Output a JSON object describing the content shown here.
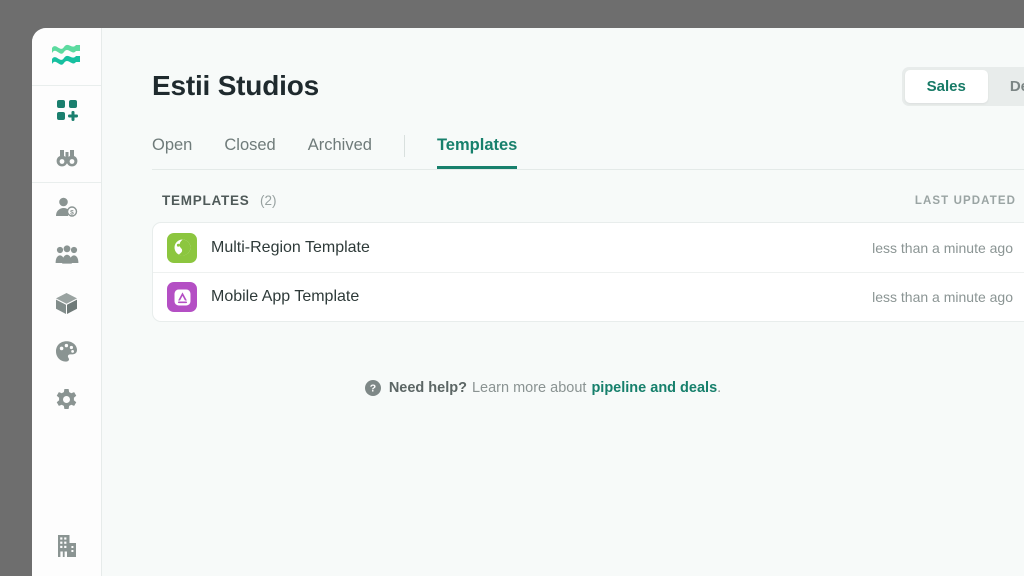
{
  "window": {
    "backdrop_color": "#6e6e6e",
    "surface_color": "#f7faf9",
    "accent_color": "#17806c"
  },
  "sidebar": {
    "logo": {
      "name": "estii-wave-logo",
      "color_top": "#5ddba0",
      "color_bottom": "#17c0a0"
    },
    "items": [
      {
        "name": "grid-plus-icon",
        "label": "Dashboard",
        "color": "#1a7f6e"
      },
      {
        "name": "binoculars-icon",
        "label": "Explore",
        "color": "#8a9492"
      },
      {
        "name": "person-dollar-icon",
        "label": "Sales",
        "color": "#8a9492"
      },
      {
        "name": "people-icon",
        "label": "Team",
        "color": "#8a9492"
      },
      {
        "name": "box-icon",
        "label": "Products",
        "color": "#8a9492"
      },
      {
        "name": "palette-icon",
        "label": "Branding",
        "color": "#8a9492"
      },
      {
        "name": "gear-icon",
        "label": "Settings",
        "color": "#8a9492"
      }
    ],
    "bottom_item": {
      "name": "building-icon",
      "label": "Company",
      "color": "#8a9492"
    }
  },
  "header": {
    "title": "Estii Studios",
    "toggle": {
      "options": [
        {
          "label": "Sales",
          "active": true
        },
        {
          "label": "De",
          "active": false
        }
      ]
    }
  },
  "tabs": [
    {
      "label": "Open",
      "active": false
    },
    {
      "label": "Closed",
      "active": false
    },
    {
      "label": "Archived",
      "active": false
    },
    {
      "label": "Templates",
      "active": true
    }
  ],
  "list": {
    "section_title": "TEMPLATES",
    "section_count": "(2)",
    "column_last_updated": "LAST UPDATED",
    "rows": [
      {
        "icon_name": "globe-icon",
        "icon_bg": "#8cc63f",
        "label": "Multi-Region Template",
        "last_updated": "less than a minute ago"
      },
      {
        "icon_name": "app-store-icon",
        "icon_bg": "#b44fc4",
        "label": "Mobile App Template",
        "last_updated": "less than a minute ago"
      }
    ]
  },
  "help": {
    "icon_name": "question-circle-icon",
    "strong": "Need help?",
    "middle": "Learn more about",
    "link": "pipeline and deals",
    "period": "."
  }
}
